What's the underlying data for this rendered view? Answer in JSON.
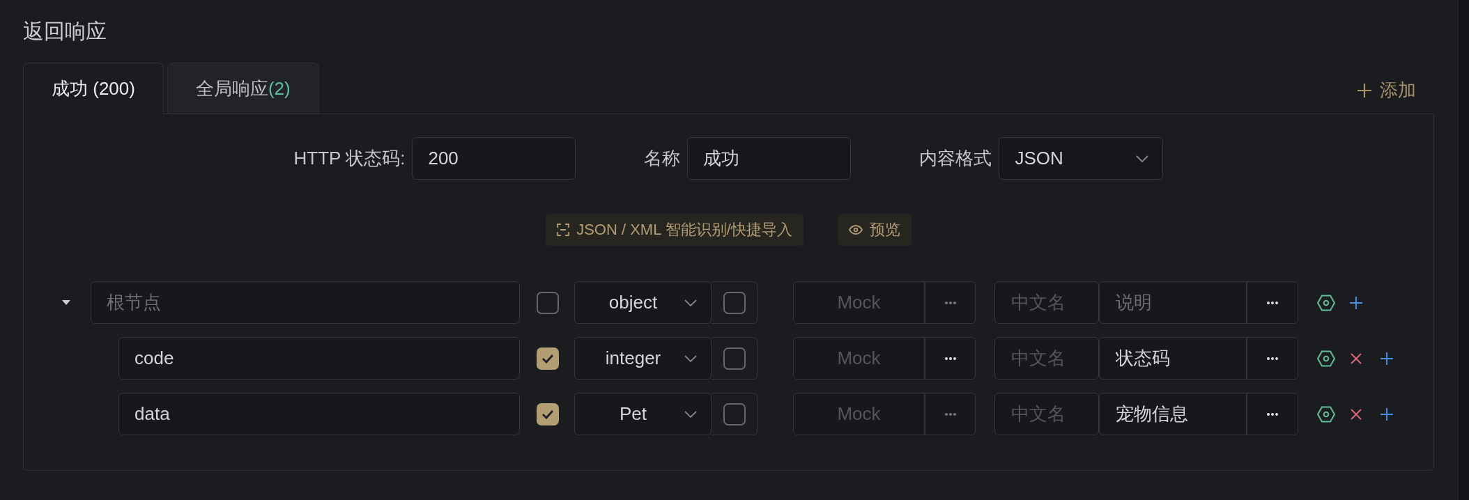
{
  "section_title": "返回响应",
  "tabs": [
    {
      "label": "成功 (200)",
      "selected": true
    },
    {
      "label": "全局响应",
      "count": "(2)",
      "selected": false
    }
  ],
  "add_button": {
    "label": "添加"
  },
  "form": [
    {
      "kind": "input",
      "label": "HTTP 状态码:",
      "value": "200"
    },
    {
      "kind": "input",
      "label": "名称",
      "value": "成功"
    },
    {
      "kind": "select",
      "label": "内容格式",
      "value": "JSON"
    }
  ],
  "actions": [
    {
      "kind": "import",
      "label": "JSON / XML 智能识别/快捷导入"
    },
    {
      "kind": "preview",
      "label": "预览"
    }
  ],
  "schema": {
    "root": {
      "name_placeholder": "根节点",
      "required": false,
      "type": "object",
      "nullable": false,
      "mock_placeholder": "Mock",
      "mock_more_disabled": true,
      "title_placeholder": "中文名",
      "description_placeholder": "说明",
      "removable": false,
      "expanded": true,
      "children": [
        {
          "name": "code",
          "required": true,
          "type": "integer",
          "nullable": false,
          "mock_placeholder": "Mock",
          "mock_more_disabled": false,
          "title_placeholder": "中文名",
          "description": "状态码",
          "removable": true
        },
        {
          "name": "data",
          "required": true,
          "type": "Pet",
          "nullable": false,
          "mock_placeholder": "Mock",
          "mock_more_disabled": true,
          "title_placeholder": "中文名",
          "description": "宠物信息",
          "removable": true
        }
      ]
    }
  }
}
